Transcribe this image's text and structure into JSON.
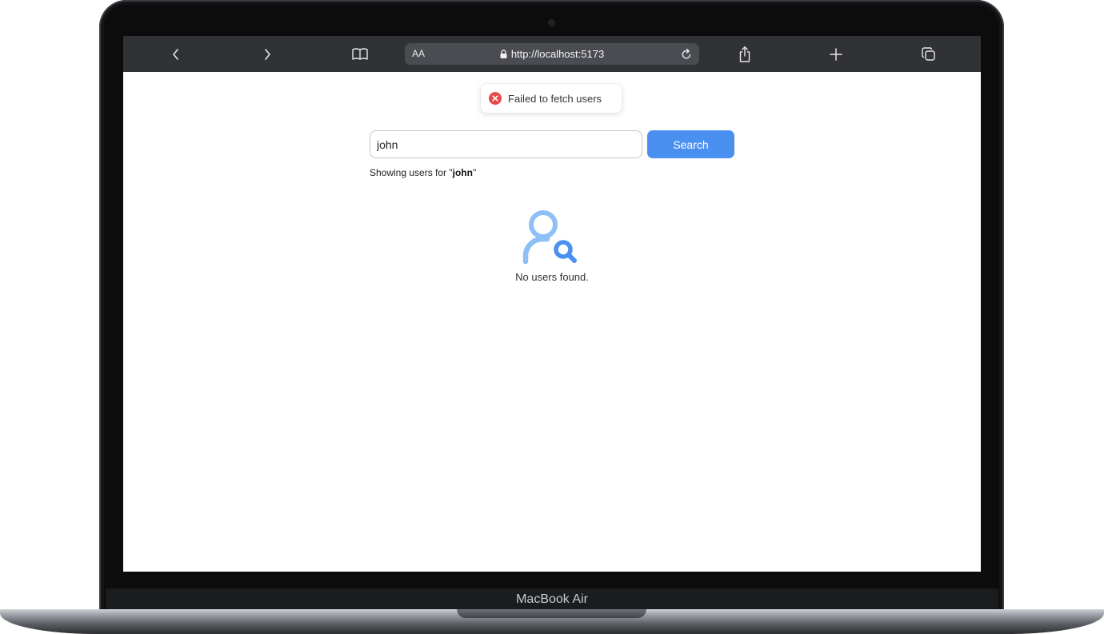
{
  "browser": {
    "text_size_label": "AA",
    "url": "http://localhost:5173"
  },
  "toast": {
    "message": "Failed to fetch users"
  },
  "search": {
    "value": "john",
    "button_label": "Search"
  },
  "results": {
    "showing_prefix": "Showing users for \"",
    "query": "john",
    "showing_suffix": "\"",
    "empty_message": "No users found."
  },
  "device": {
    "brand_label": "MacBook Air"
  },
  "colors": {
    "accent": "#4a90f0",
    "error": "#e84a4a",
    "empty_icon": "#8ec0f6"
  },
  "icons": {
    "toolbar": [
      "chevron-left-icon",
      "chevron-right-icon",
      "book-icon",
      "lock-icon",
      "reload-icon",
      "share-icon",
      "plus-icon",
      "tabs-icon"
    ],
    "toast": "error-x-icon",
    "empty_state": "user-search-icon"
  }
}
